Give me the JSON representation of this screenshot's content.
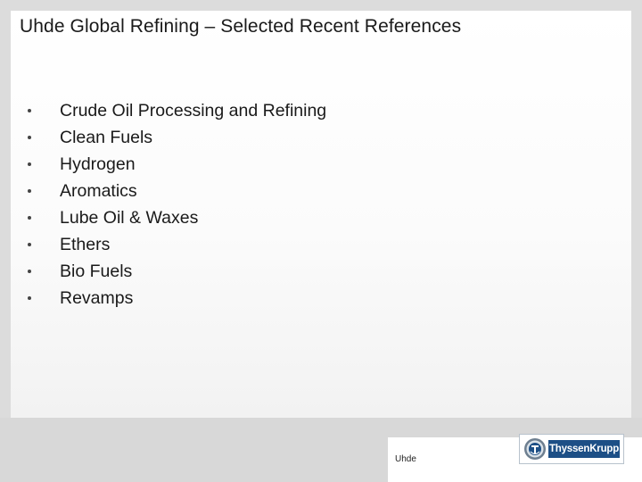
{
  "slide": {
    "title": "Uhde Global Refining – Selected Recent References",
    "bullets": [
      "Crude Oil Processing and Refining",
      "Clean Fuels",
      "Hydrogen",
      "Aromatics",
      "Lube Oil & Waxes",
      "Ethers",
      "Bio Fuels",
      "Revamps"
    ]
  },
  "footer": {
    "company_label": "Uhde",
    "logo_text": "ThyssenKrupp",
    "logo_icon": "thyssenkrupp-emblem-icon",
    "brand_blue": "#1d4f86"
  }
}
